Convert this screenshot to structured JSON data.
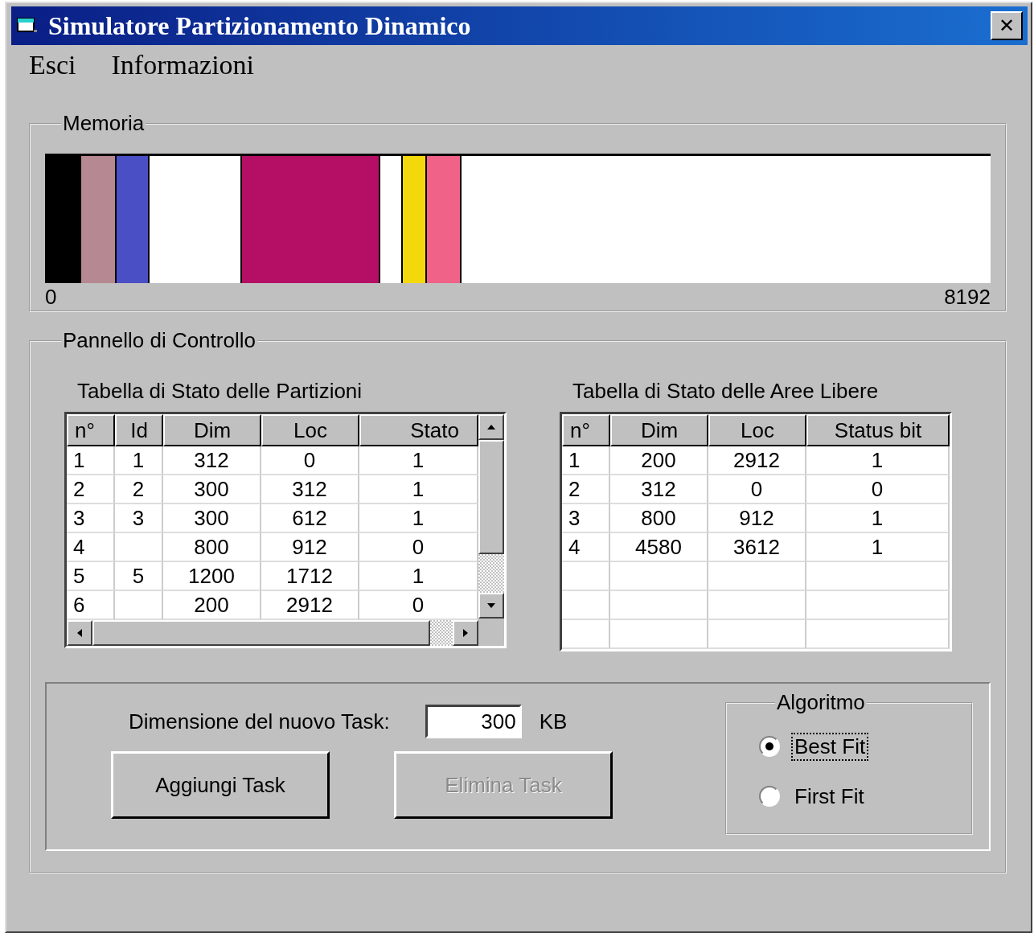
{
  "window": {
    "title": "Simulatore Partizionamento Dinamico",
    "close": "✕"
  },
  "menu": [
    {
      "label": "Esci"
    },
    {
      "label": "Informazioni"
    }
  ],
  "memory": {
    "title": "Memoria",
    "start": "0",
    "end": "8192",
    "segments": [
      {
        "color": "#000000"
      },
      {
        "color": "#b58892"
      },
      {
        "color": "#4b4fc6"
      },
      {
        "color": "#ffffff"
      },
      {
        "color": "#b50f65"
      },
      {
        "color": "#ffffff"
      },
      {
        "color": "#f3d80c"
      },
      {
        "color": "#f06288"
      }
    ]
  },
  "control_panel": {
    "title": "Pannello di Controllo",
    "partitions": {
      "title": "Tabella di Stato delle Partizioni",
      "columns": [
        "n°",
        "Id",
        "Dim",
        "Loc",
        "Stato"
      ],
      "rows": [
        [
          "1",
          "1",
          "312",
          "0",
          "1"
        ],
        [
          "2",
          "2",
          "300",
          "312",
          "1"
        ],
        [
          "3",
          "3",
          "300",
          "612",
          "1"
        ],
        [
          "4",
          null,
          "800",
          "912",
          "0"
        ],
        [
          "5",
          "5",
          "1200",
          "1712",
          "1"
        ],
        [
          "6",
          null,
          "200",
          "2912",
          "0"
        ]
      ]
    },
    "free_areas": {
      "title": "Tabella di Stato delle Aree Libere",
      "columns": [
        "n°",
        "Dim",
        "Loc",
        "Status bit"
      ],
      "rows": [
        [
          "1",
          "200",
          "2912",
          "1"
        ],
        [
          "2",
          "312",
          "0",
          "0"
        ],
        [
          "3",
          "800",
          "912",
          "1"
        ],
        [
          "4",
          "4580",
          "3612",
          "1"
        ]
      ]
    },
    "size_label": "Dimensione del nuovo Task:",
    "size_value": "300",
    "unit": "KB",
    "buttons": [
      {
        "label": "Aggiungi Task",
        "disabled": false
      },
      {
        "label": "Elimina Task",
        "disabled": true
      }
    ],
    "algorithm": {
      "title": "Algoritmo",
      "options": [
        {
          "label": "Best Fit",
          "selected": true
        },
        {
          "label": "First Fit",
          "selected": false
        }
      ]
    }
  }
}
